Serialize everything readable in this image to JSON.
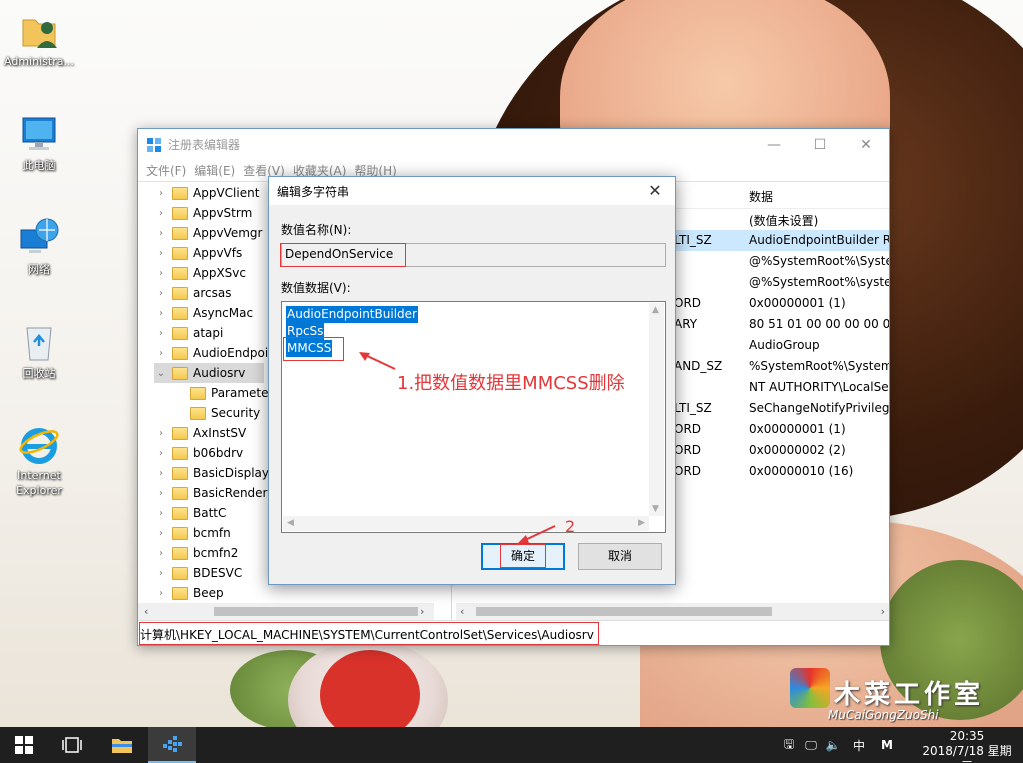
{
  "desktop": {
    "icons": [
      {
        "label": "Administra..."
      },
      {
        "label": "此电脑"
      },
      {
        "label": "网络"
      },
      {
        "label": "回收站"
      },
      {
        "label": "Internet Explorer"
      }
    ],
    "watermark": {
      "title": "木菜工作室",
      "subtitle": "MuCaiGongZuoShi"
    }
  },
  "regedit": {
    "title": "注册表编辑器",
    "menu": [
      "文件(F)",
      "编辑(E)",
      "查看(V)",
      "收藏夹(A)",
      "帮助(H)"
    ],
    "tree": [
      {
        "name": "AppVClient",
        "expander": "›"
      },
      {
        "name": "AppvStrm",
        "expander": "›"
      },
      {
        "name": "AppvVemgr",
        "expander": "›"
      },
      {
        "name": "AppvVfs",
        "expander": "›"
      },
      {
        "name": "AppXSvc",
        "expander": "›"
      },
      {
        "name": "arcsas",
        "expander": "›"
      },
      {
        "name": "AsyncMac",
        "expander": "›"
      },
      {
        "name": "atapi",
        "expander": "›"
      },
      {
        "name": "AudioEndpoi",
        "expander": "›"
      },
      {
        "name": "Audiosrv",
        "expander": "⌄",
        "selected": true
      },
      {
        "name": "Paramete",
        "expander": "",
        "child": true
      },
      {
        "name": "Security",
        "expander": "",
        "child": true
      },
      {
        "name": "AxInstSV",
        "expander": "›"
      },
      {
        "name": "b06bdrv",
        "expander": "›"
      },
      {
        "name": "BasicDisplay",
        "expander": "›"
      },
      {
        "name": "BasicRender",
        "expander": "›"
      },
      {
        "name": "BattC",
        "expander": "›"
      },
      {
        "name": "bcmfn",
        "expander": "›"
      },
      {
        "name": "bcmfn2",
        "expander": "›"
      },
      {
        "name": "BDESVC",
        "expander": "›"
      },
      {
        "name": "Beep",
        "expander": "›"
      }
    ],
    "list_header_data": "数据",
    "list": [
      {
        "type": "",
        "data": "(数值未设置)"
      },
      {
        "type": "LTI_SZ",
        "data": "AudioEndpointBuilder R",
        "selected": true
      },
      {
        "type": "",
        "data": "@%SystemRoot%\\System"
      },
      {
        "type": "",
        "data": "@%SystemRoot%\\syster"
      },
      {
        "type": "ORD",
        "data": "0x00000001 (1)"
      },
      {
        "type": "ARY",
        "data": "80 51 01 00 00 00 00 00"
      },
      {
        "type": "",
        "data": "AudioGroup"
      },
      {
        "type": "AND_SZ",
        "data": "%SystemRoot%\\System3"
      },
      {
        "type": "",
        "data": "NT AUTHORITY\\LocalSe"
      },
      {
        "type": "LTI_SZ",
        "data": "SeChangeNotifyPrivilege"
      },
      {
        "type": "ORD",
        "data": "0x00000001 (1)"
      },
      {
        "type": "ORD",
        "data": "0x00000002 (2)"
      },
      {
        "type": "ORD",
        "data": "0x00000010 (16)"
      }
    ],
    "status_path": "计算机\\HKEY_LOCAL_MACHINE\\SYSTEM\\CurrentControlSet\\Services\\Audiosrv"
  },
  "dialog": {
    "title": "编辑多字符串",
    "name_label": "数值名称(N):",
    "name_value": "DependOnService",
    "data_label": "数值数据(V):",
    "data_lines": [
      "AudioEndpointBuilder",
      "RpcSs",
      "MMCSS"
    ],
    "ok_label": "确定",
    "cancel_label": "取消"
  },
  "annotations": {
    "note1": "1.把数值数据里MMCSS删除",
    "note2": "2"
  },
  "taskbar": {
    "ime": "中",
    "ime_mode": "M",
    "time": "20:35",
    "date": "2018/7/18 星期三"
  },
  "colors": {
    "accent": "#0078d7",
    "annotation": "#e2383a",
    "taskbar": "#1f1f1f"
  }
}
